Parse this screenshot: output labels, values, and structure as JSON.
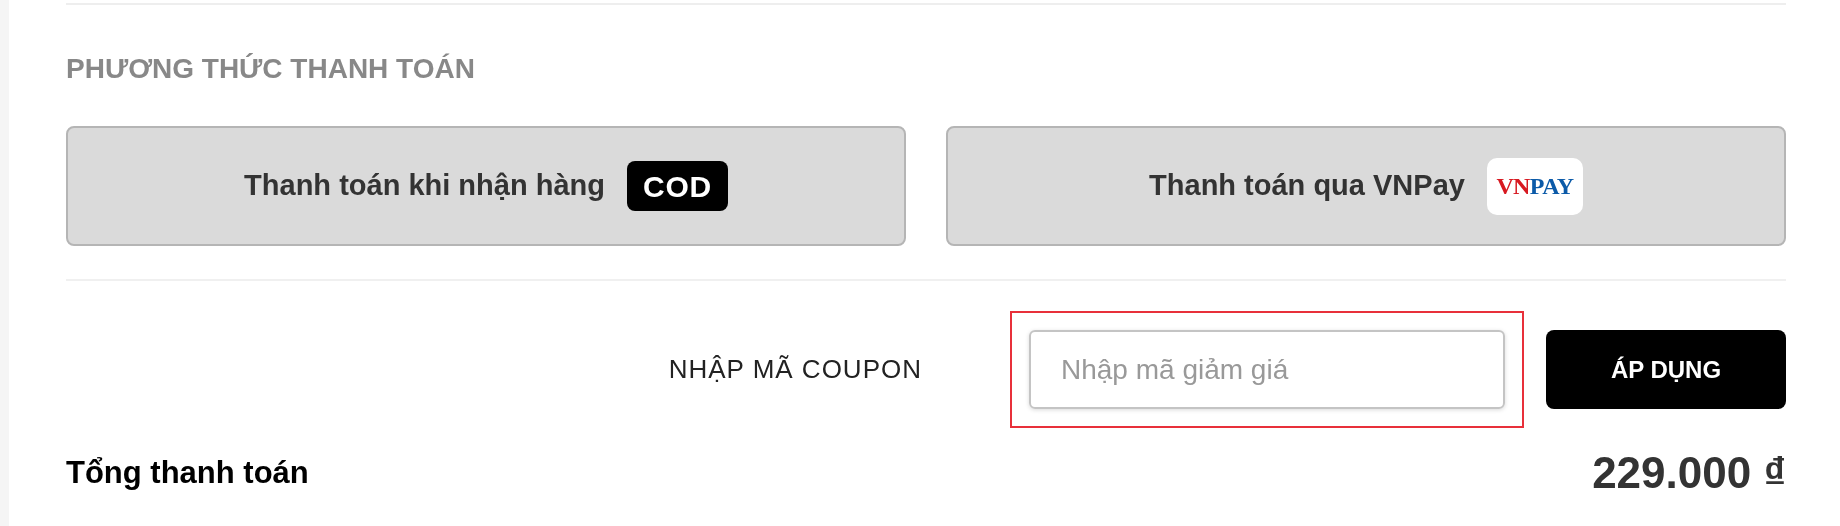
{
  "payment": {
    "heading": "PHƯƠNG THỨC THANH TOÁN",
    "options": [
      {
        "label": "Thanh toán khi nhận hàng",
        "selected": false,
        "badge": {
          "kind": "tag",
          "parts": [
            {
              "text": "COD",
              "color": "#ffffff"
            }
          ]
        }
      },
      {
        "label": "Thanh toán qua VNPay",
        "selected": false,
        "badge": {
          "kind": "logo",
          "parts": [
            {
              "text": "VN",
              "color": "#d71921"
            },
            {
              "text": "PAY",
              "color": "#0b5aa8"
            }
          ]
        }
      }
    ]
  },
  "coupon": {
    "label": "NHẬP MÃ COUPON",
    "placeholder": "Nhập mã giảm giá",
    "focused": true,
    "button": "ÁP DỤNG"
  },
  "total": {
    "label": "Tổng thanh toán",
    "amount": "229.000 ₫"
  }
}
